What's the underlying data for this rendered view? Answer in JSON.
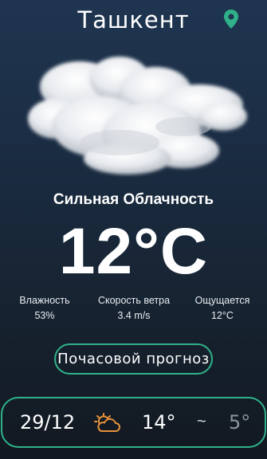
{
  "header": {
    "city": "Ташкент",
    "location_icon": "location-pin-icon",
    "accent_color": "#2fb28a"
  },
  "current": {
    "condition_icon": "cloud-icon",
    "condition": "Сильная Облачность",
    "temperature": "12°C"
  },
  "stats": {
    "humidity_label": "Влажность",
    "humidity_value": "53%",
    "wind_label": "Скорость ветра",
    "wind_value": "3.4 m/s",
    "feels_label": "Ощущается",
    "feels_value": "12°C"
  },
  "hourly_button": {
    "label": "Почасовой прогноз"
  },
  "forecast": [
    {
      "date": "29/12",
      "icon": "partly-cloudy-icon",
      "icon_color": "#e8923a",
      "high": "14°",
      "separator": "~",
      "low": "5°"
    }
  ]
}
